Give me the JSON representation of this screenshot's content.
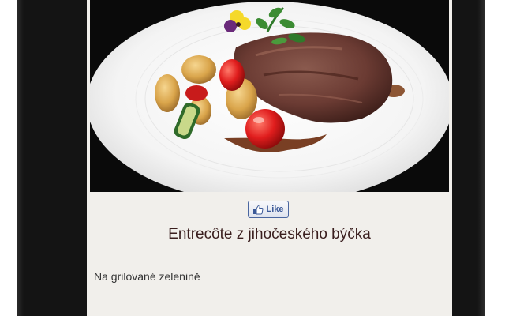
{
  "dish": {
    "image_subject": "steak-plate-photo",
    "title": "Entrecôte z jihočeského býčka",
    "description": "Na grilované zelenině"
  },
  "social": {
    "like_label": "Like",
    "like_icon": "thumbs-up-icon",
    "brand_color": "#3b5998"
  },
  "colors": {
    "frame": "#141414",
    "screen_background": "#f1efeb",
    "title_color": "#3a1e1e"
  }
}
